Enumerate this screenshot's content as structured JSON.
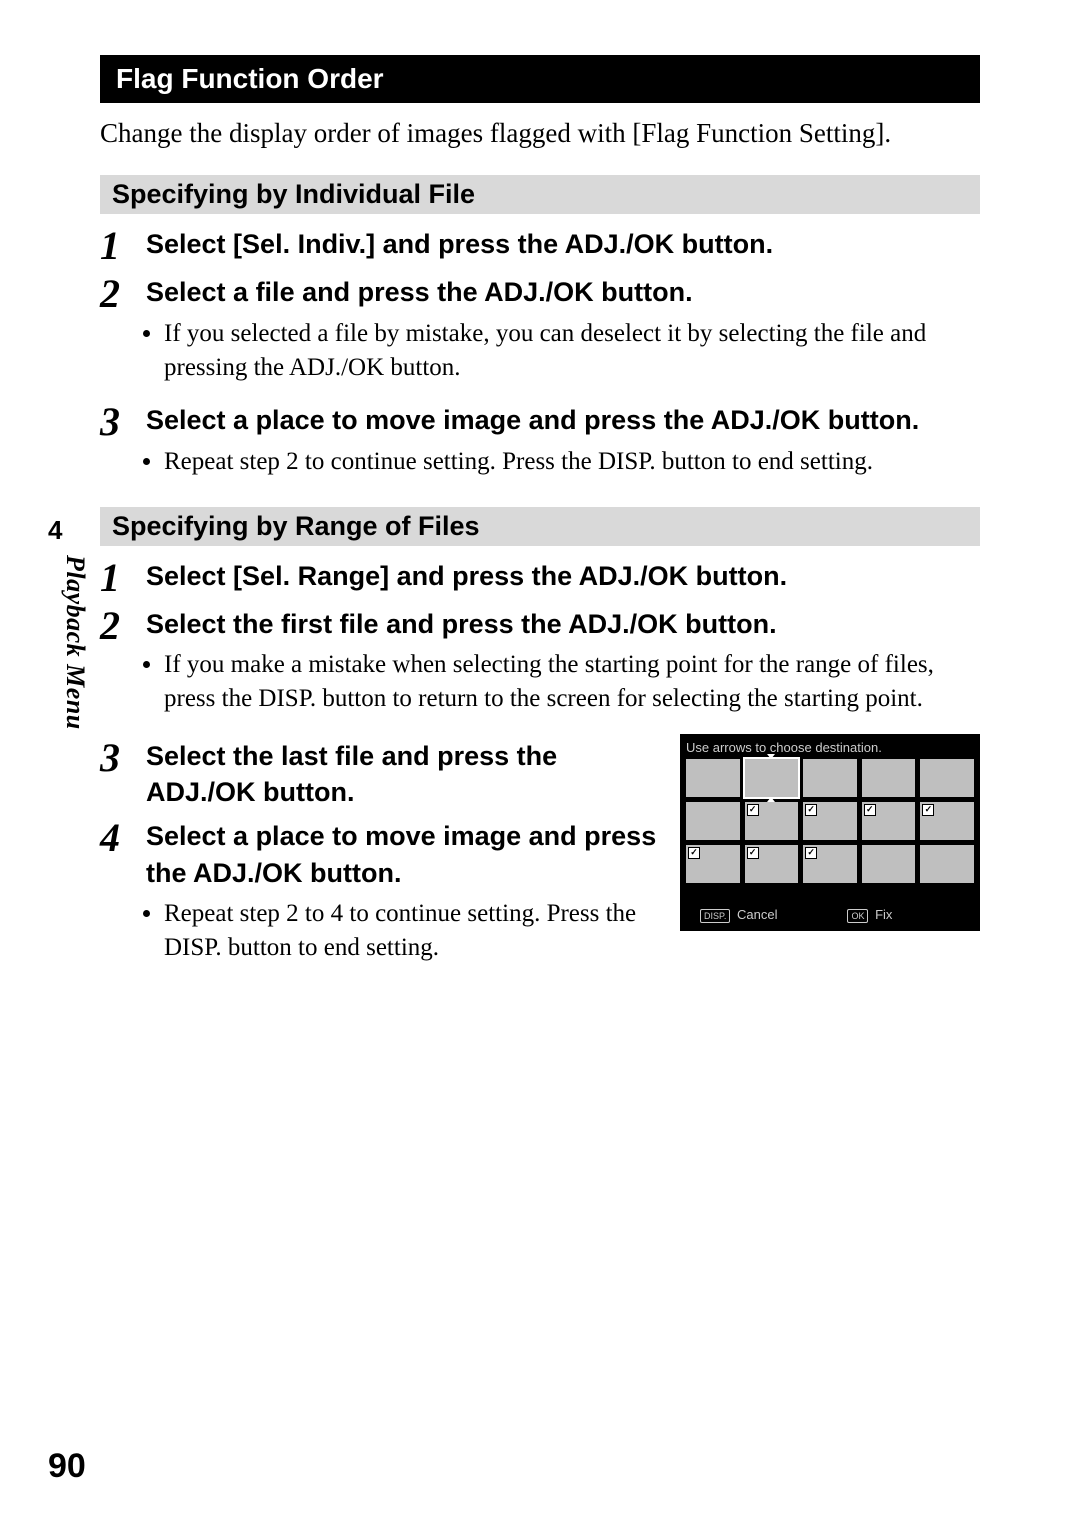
{
  "title": "Flag Function Order",
  "intro": "Change the display order of images flagged with [Flag Function Setting].",
  "sections": [
    {
      "heading": "Specifying by Individual File",
      "steps": [
        {
          "num": "1",
          "title": "Select [Sel. Indiv.] and press the ADJ./OK button.",
          "bullets": []
        },
        {
          "num": "2",
          "title": "Select a file and press the ADJ./OK button.",
          "bullets": [
            "If you selected a file by mistake, you can deselect it by selecting the file and pressing the ADJ./OK button."
          ]
        },
        {
          "num": "3",
          "title": "Select a place to move image and press the ADJ./OK button.",
          "bullets": [
            "Repeat step 2 to continue setting. Press the DISP. button to end setting."
          ]
        }
      ]
    },
    {
      "heading": "Specifying by Range of Files",
      "steps": [
        {
          "num": "1",
          "title": "Select [Sel. Range] and press the ADJ./OK button.",
          "bullets": []
        },
        {
          "num": "2",
          "title": "Select the first file and press the ADJ./OK button.",
          "bullets": [
            "If you make a mistake when selecting the starting point for the range of files, press the DISP. button to return to the screen for selecting the starting point."
          ]
        },
        {
          "num": "3",
          "title": "Select the last file and press the ADJ./OK button.",
          "bullets": []
        },
        {
          "num": "4",
          "title": "Select a place to move image and press the ADJ./OK button.",
          "bullets": [
            "Repeat step 2 to 4 to continue setting. Press the DISP. button to end setting."
          ]
        }
      ]
    }
  ],
  "screen": {
    "title": "Use arrows to choose destination.",
    "thumbs": [
      {
        "checked": false,
        "selected": false
      },
      {
        "checked": false,
        "selected": true
      },
      {
        "checked": false,
        "selected": false
      },
      {
        "checked": false,
        "selected": false
      },
      {
        "checked": false,
        "selected": false
      },
      {
        "checked": false,
        "selected": false
      },
      {
        "checked": true,
        "selected": false
      },
      {
        "checked": true,
        "selected": false
      },
      {
        "checked": true,
        "selected": false
      },
      {
        "checked": true,
        "selected": false
      },
      {
        "checked": true,
        "selected": false
      },
      {
        "checked": true,
        "selected": false
      },
      {
        "checked": true,
        "selected": false
      },
      {
        "checked": false,
        "selected": false
      },
      {
        "checked": false,
        "selected": false
      }
    ],
    "footer": {
      "cancel_key": "DISP.",
      "cancel_label": "Cancel",
      "ok_key": "OK",
      "ok_label": "Fix"
    }
  },
  "side": {
    "chapter": "4",
    "label": "Playback Menu"
  },
  "page_number": "90"
}
